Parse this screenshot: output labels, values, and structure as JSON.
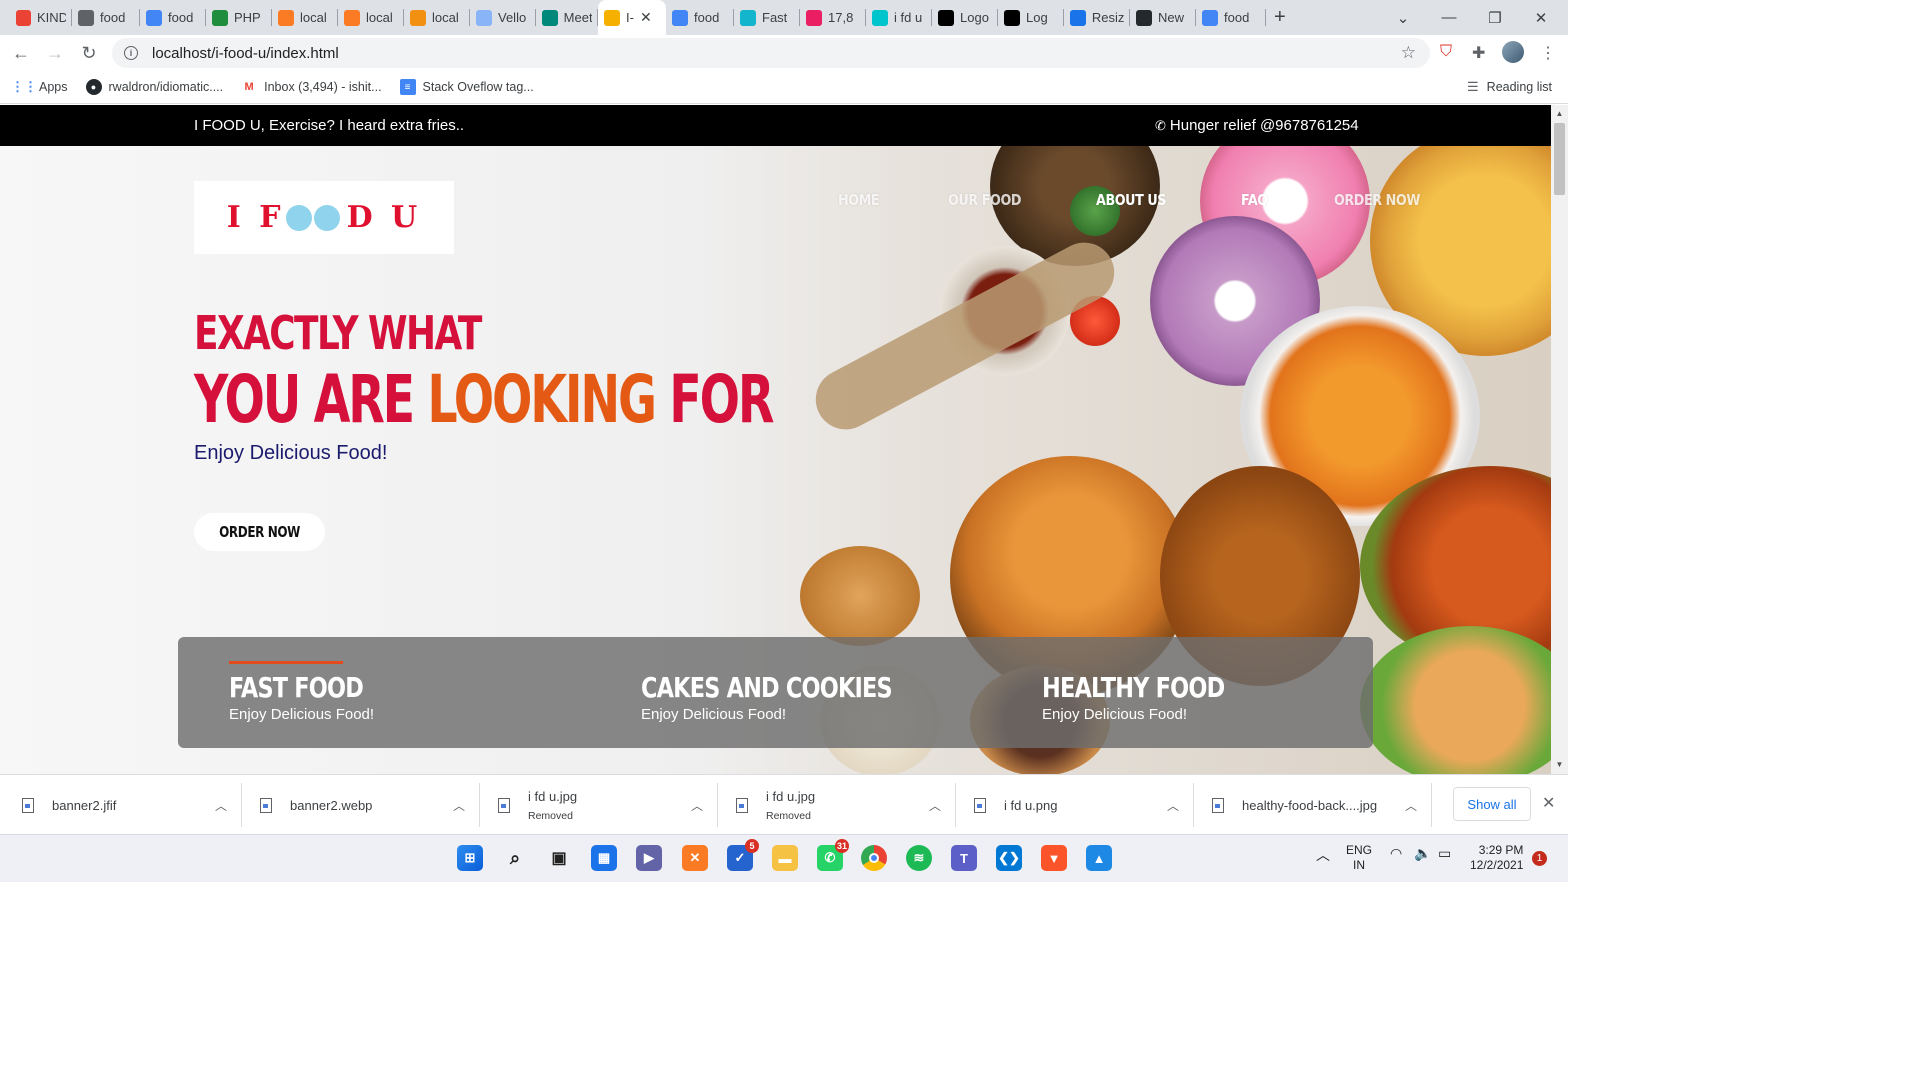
{
  "browser": {
    "tabs": [
      {
        "label": "KIND",
        "icon": "gmail-icon",
        "color": "#ea4335"
      },
      {
        "label": "food",
        "icon": "globe-icon",
        "color": "#5f6368"
      },
      {
        "label": "food",
        "icon": "docs-icon",
        "color": "#4285f4"
      },
      {
        "label": "PHP",
        "icon": "check-icon",
        "color": "#1e8e3e"
      },
      {
        "label": "local",
        "icon": "xampp-icon",
        "color": "#fb7a24"
      },
      {
        "label": "local",
        "icon": "xampp-icon",
        "color": "#fb7a24"
      },
      {
        "label": "local",
        "icon": "phpmyadmin-icon",
        "color": "#f29111"
      },
      {
        "label": "Vello",
        "icon": "avatar-icon",
        "color": "#8ab4f8"
      },
      {
        "label": "Meet",
        "icon": "meet-icon",
        "color": "#00897b"
      },
      {
        "label": "I-",
        "icon": "site-icon",
        "color": "#f6b100",
        "active": true
      },
      {
        "label": "food",
        "icon": "google-icon",
        "color": "#4285f4"
      },
      {
        "label": "Fast",
        "icon": "tag-icon",
        "color": "#12b5cb"
      },
      {
        "label": "17,8",
        "icon": "swirl-icon",
        "color": "#e91e63"
      },
      {
        "label": "i fd u",
        "icon": "canva-icon",
        "color": "#00c4cc"
      },
      {
        "label": "Logo",
        "icon": "wix-icon",
        "color": "#000000"
      },
      {
        "label": "Log",
        "icon": "wix-icon",
        "color": "#000000"
      },
      {
        "label": "Resiz",
        "icon": "resize-icon",
        "color": "#1a73e8"
      },
      {
        "label": "New",
        "icon": "github-icon",
        "color": "#24292e"
      },
      {
        "label": "food",
        "icon": "google-icon",
        "color": "#4285f4"
      }
    ],
    "url": "localhost/i-food-u/index.html",
    "bookmarks": [
      {
        "label": "Apps",
        "icon": "apps-grid-icon"
      },
      {
        "label": "rwaldron/idiomatic....",
        "icon": "github-icon"
      },
      {
        "label": "Inbox (3,494) - ishit...",
        "icon": "gmail-icon"
      },
      {
        "label": "Stack Oveflow tag...",
        "icon": "docs-icon"
      }
    ],
    "reading_list": "Reading list"
  },
  "site": {
    "topbar_left": "I FOOD U, Exercise? I heard extra fries..",
    "topbar_right": "Hunger relief @9678761254",
    "logo_text_left": "I F",
    "logo_text_right": "D U",
    "nav": [
      "HOME",
      "OUR FOOD",
      "ABOUT US",
      "FAQ",
      "ORDER NOW"
    ],
    "headline_1": "EXACTLY WHAT",
    "headline_2a": "YOU ARE ",
    "headline_2b": "LOOKING ",
    "headline_2c": "FOR",
    "tagline": "Enjoy Delicious Food!",
    "order_button": "ORDER NOW",
    "categories": [
      {
        "title": "FAST FOOD",
        "subtitle": "Enjoy Delicious Food!"
      },
      {
        "title": "CAKES AND COOKIES",
        "subtitle": "Enjoy Delicious Food!"
      },
      {
        "title": "HEALTHY FOOD",
        "subtitle": "Enjoy Delicious Food!"
      }
    ],
    "colors": {
      "accent_red": "#d5103a",
      "accent_orange": "#e45a14",
      "tagline_navy": "#1b1b6e"
    }
  },
  "downloads": {
    "items": [
      {
        "name": "banner2.jfif",
        "status": ""
      },
      {
        "name": "banner2.webp",
        "status": ""
      },
      {
        "name": "i fd u.jpg",
        "status": "Removed"
      },
      {
        "name": "i fd u.jpg",
        "status": "Removed"
      },
      {
        "name": "i fd u.png",
        "status": ""
      },
      {
        "name": "healthy-food-back....jpg",
        "status": ""
      }
    ],
    "show_all": "Show all"
  },
  "taskbar": {
    "lang_1": "ENG",
    "lang_2": "IN",
    "time": "3:29 PM",
    "date": "12/2/2021",
    "notification_count": "1",
    "todo_badge": "5",
    "whatsapp_badge": "31"
  }
}
